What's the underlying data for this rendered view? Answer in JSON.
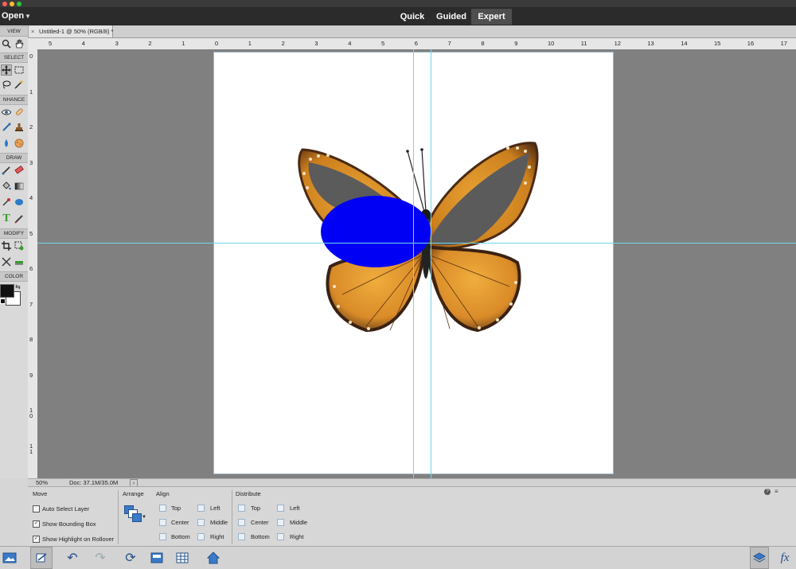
{
  "app": {
    "open_label": "Open",
    "modes": [
      {
        "label": "Quick"
      },
      {
        "label": "Guided"
      },
      {
        "label": "Expert",
        "active": true
      }
    ]
  },
  "document_tab": {
    "close_symbol": "×",
    "title": "Untitled-1 @ 50% (RGB/8) *"
  },
  "toolbox": {
    "sections": [
      "VIEW",
      "SELECT",
      "NHANCE",
      "DRAW",
      "MODIFY",
      "COLOR"
    ]
  },
  "rulers": {
    "horizontal": [
      "5",
      "4",
      "3",
      "2",
      "1",
      "0",
      "1",
      "2",
      "3",
      "4",
      "5",
      "6",
      "7",
      "8",
      "9",
      "10",
      "11",
      "12",
      "13",
      "14",
      "15",
      "16",
      "17"
    ],
    "vertical": [
      "0",
      "1",
      "2",
      "3",
      "4",
      "5",
      "6",
      "7",
      "8",
      "9",
      "10",
      "11"
    ]
  },
  "status": {
    "zoom": "50%",
    "doc": "Doc: 37.1M/35.0M"
  },
  "options": {
    "move": {
      "title": "Move",
      "checkboxes": [
        {
          "label": "Auto Select Layer",
          "checked": false
        },
        {
          "label": "Show Bounding Box",
          "checked": true
        },
        {
          "label": "Show Highlight on Rollover",
          "checked": true
        }
      ]
    },
    "arrange": {
      "title": "Arrange"
    },
    "align": {
      "title": "Align",
      "vertical": [
        "Top",
        "Center",
        "Bottom"
      ],
      "horizontal": [
        "Left",
        "Middle",
        "Right"
      ]
    },
    "distribute": {
      "title": "Distribute",
      "vertical": [
        "Top",
        "Center",
        "Bottom"
      ],
      "horizontal": [
        "Left",
        "Middle",
        "Right"
      ]
    }
  },
  "colors": {
    "oval": "#0000f5",
    "wing_cover": "#5b5b5b",
    "guide": "#6fd7f0",
    "active_mode_bg": "#4e4e4e"
  }
}
